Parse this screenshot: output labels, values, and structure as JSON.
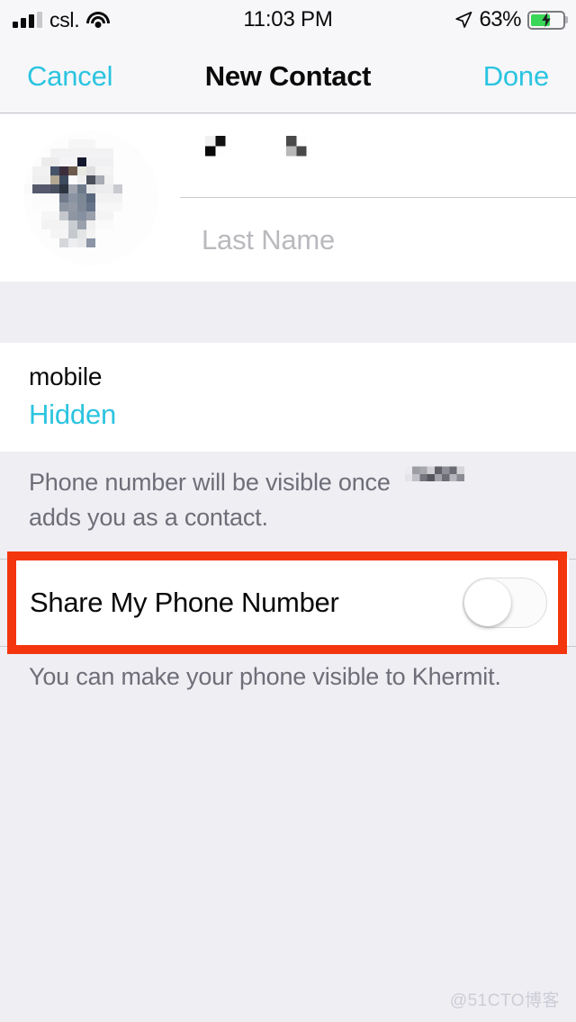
{
  "status_bar": {
    "carrier": "csl.",
    "time": "11:03 PM",
    "battery_percent": "63%",
    "battery_level": 63,
    "charging": true,
    "signal_bars_filled": 3,
    "signal_bars_total": 4,
    "wifi_icon": "wifi-icon",
    "location_icon": "location-arrow-icon",
    "battery_icon": "battery-charging-icon"
  },
  "nav_bar": {
    "cancel_label": "Cancel",
    "title": "New Contact",
    "done_label": "Done"
  },
  "name_section": {
    "avatar_name": "contact-avatar",
    "first_name_value": "",
    "first_name_redacted": true,
    "last_name_placeholder": "Last Name",
    "last_name_value": ""
  },
  "phone_section": {
    "label": "mobile",
    "value": "Hidden",
    "note": "Phone number will be visible once",
    "note_redacted_name": true,
    "note_tail": "adds you as a contact."
  },
  "share_section": {
    "toggle_label": "Share My Phone Number",
    "toggle_on": false,
    "footer_note": "You can make your phone visible to Khermit."
  },
  "annotation": {
    "highlight_color": "#f4360f",
    "target": "share-my-phone-number-row"
  },
  "colors": {
    "accent": "#2bc4e0",
    "group_background": "#efeef3",
    "card_background": "#ffffff",
    "bar_background": "#f7f7f9",
    "separator": "#c9c9ce",
    "secondary_text": "#6e6e78",
    "placeholder_text": "#b9b9be",
    "battery_green": "#3ad658",
    "highlight_red": "#f4360f"
  },
  "watermark": {
    "text": "@51CTO博客"
  }
}
